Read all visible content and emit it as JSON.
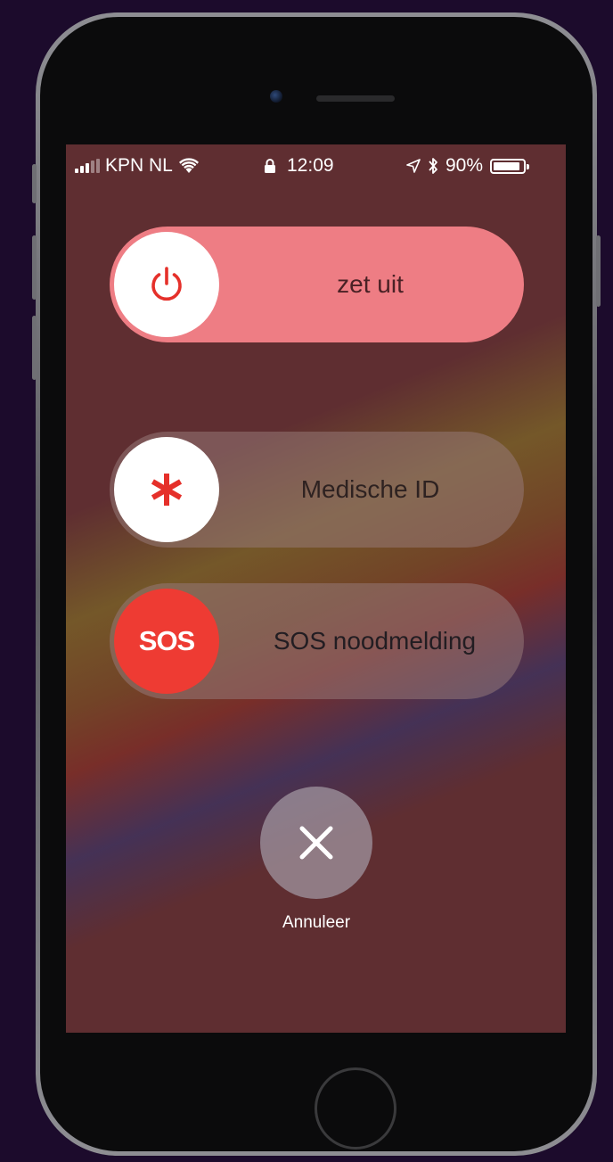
{
  "status_bar": {
    "carrier": "KPN NL",
    "time": "12:09",
    "battery_percent": "90%",
    "battery_level": 0.9,
    "icons": [
      "signal-icon",
      "wifi-icon",
      "lock-icon",
      "location-icon",
      "bluetooth-icon",
      "battery-icon"
    ]
  },
  "sliders": {
    "power": {
      "label": "zet uit",
      "icon": "power-icon",
      "color": "#ee7d84"
    },
    "medical": {
      "label": "Medische ID",
      "icon": "asterisk-icon"
    },
    "sos": {
      "label": "SOS noodmelding",
      "knob_text": "SOS",
      "color": "#ee3b33"
    }
  },
  "cancel": {
    "label": "Annuleer",
    "icon": "close-icon"
  },
  "colors": {
    "screen_background": "#5f2e31",
    "accent_red": "#e5302a"
  }
}
